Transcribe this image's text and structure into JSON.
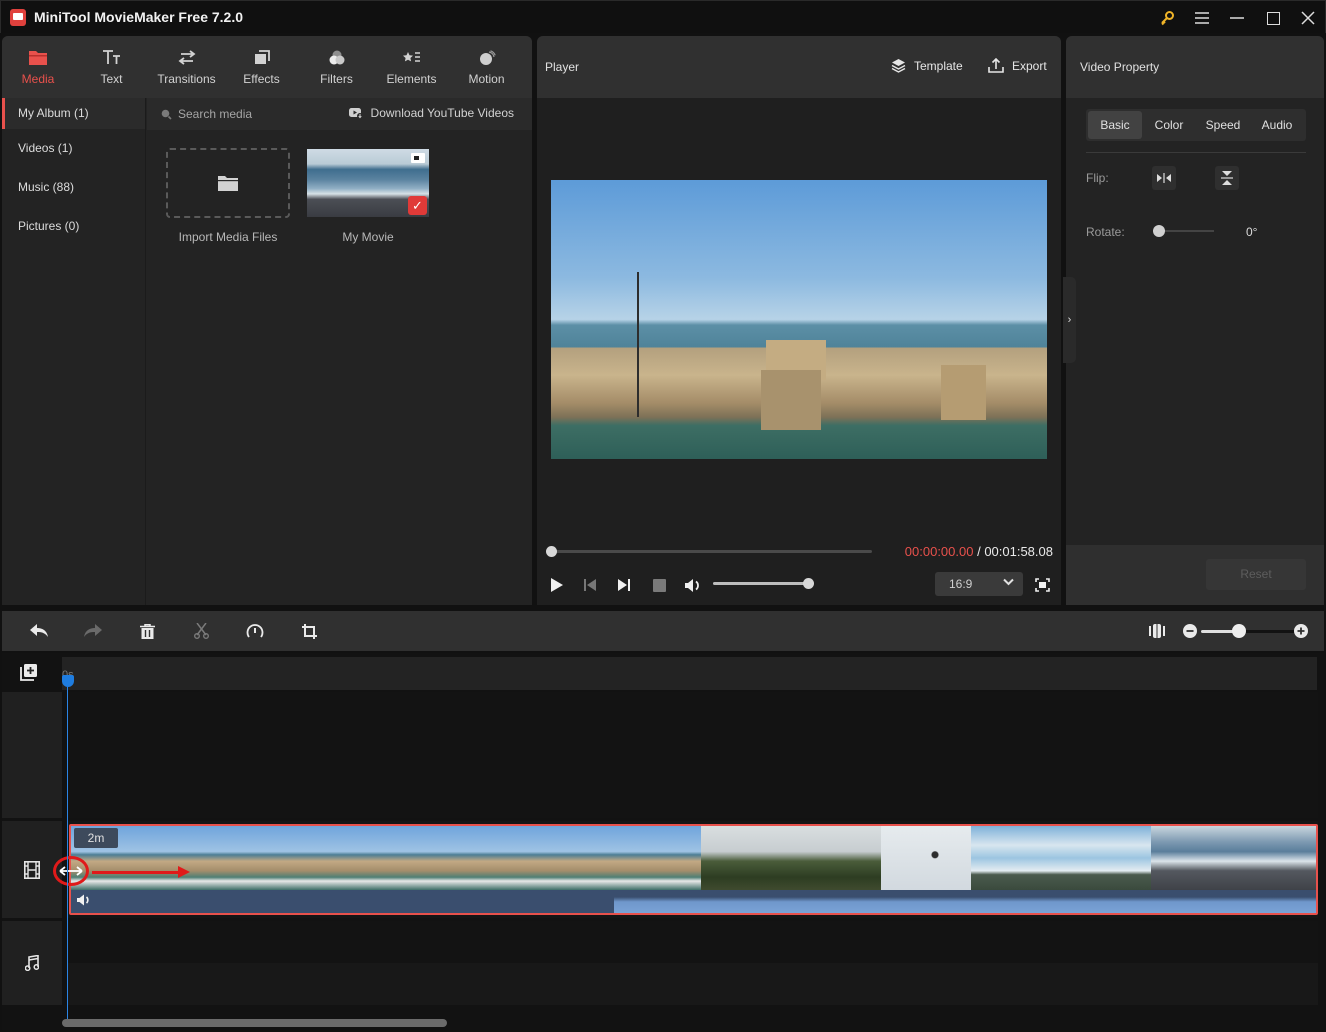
{
  "app": {
    "title": "MiniTool MovieMaker Free 7.2.0",
    "window_controls": [
      "key-icon",
      "menu-icon",
      "minimize-icon",
      "maximize-icon",
      "close-icon"
    ],
    "accent_color": "#e8514c"
  },
  "media_tabs": [
    {
      "label": "Media",
      "icon": "folder-icon",
      "active": true
    },
    {
      "label": "Text",
      "icon": "text-icon",
      "active": false
    },
    {
      "label": "Transitions",
      "icon": "transitions-icon",
      "active": false
    },
    {
      "label": "Effects",
      "icon": "effects-icon",
      "active": false
    },
    {
      "label": "Filters",
      "icon": "filters-icon",
      "active": false
    },
    {
      "label": "Elements",
      "icon": "elements-icon",
      "active": false
    },
    {
      "label": "Motion",
      "icon": "motion-icon",
      "active": false
    }
  ],
  "album_nav": [
    {
      "label": "My Album (1)",
      "active": true
    },
    {
      "label": "Videos (1)",
      "active": false
    },
    {
      "label": "Music (88)",
      "active": false
    },
    {
      "label": "Pictures (0)",
      "active": false
    }
  ],
  "media": {
    "search_placeholder": "Search media",
    "download_label": "Download YouTube Videos",
    "import_label": "Import Media Files",
    "items": [
      {
        "name": "My Movie",
        "type": "video",
        "selected": true
      }
    ]
  },
  "player": {
    "title": "Player",
    "template_label": "Template",
    "export_label": "Export",
    "current_time": "00:00:00.00",
    "separator": " / ",
    "total_time": "00:01:58.08",
    "progress": 0,
    "volume": 1.0,
    "aspect_ratio": "16:9"
  },
  "property": {
    "title": "Video Property",
    "tabs": [
      {
        "label": "Basic",
        "active": true
      },
      {
        "label": "Color",
        "active": false
      },
      {
        "label": "Speed",
        "active": false
      },
      {
        "label": "Audio",
        "active": false
      }
    ],
    "flip_label": "Flip:",
    "rotate_label": "Rotate:",
    "rotate_value": "0°",
    "reset_label": "Reset"
  },
  "timeline": {
    "tools": [
      "undo-icon",
      "redo-icon",
      "delete-icon",
      "split-icon",
      "speed-icon",
      "crop-icon"
    ],
    "zoom_level": 0.38,
    "ruler_start": "0s",
    "clip": {
      "duration_badge": "2m",
      "frames": [
        "marina",
        "marina",
        "marina",
        "marina",
        "marina",
        "marina",
        "marina",
        "bush",
        "bush",
        "plane",
        "cloud",
        "cloud",
        "beach",
        "beach"
      ]
    }
  }
}
